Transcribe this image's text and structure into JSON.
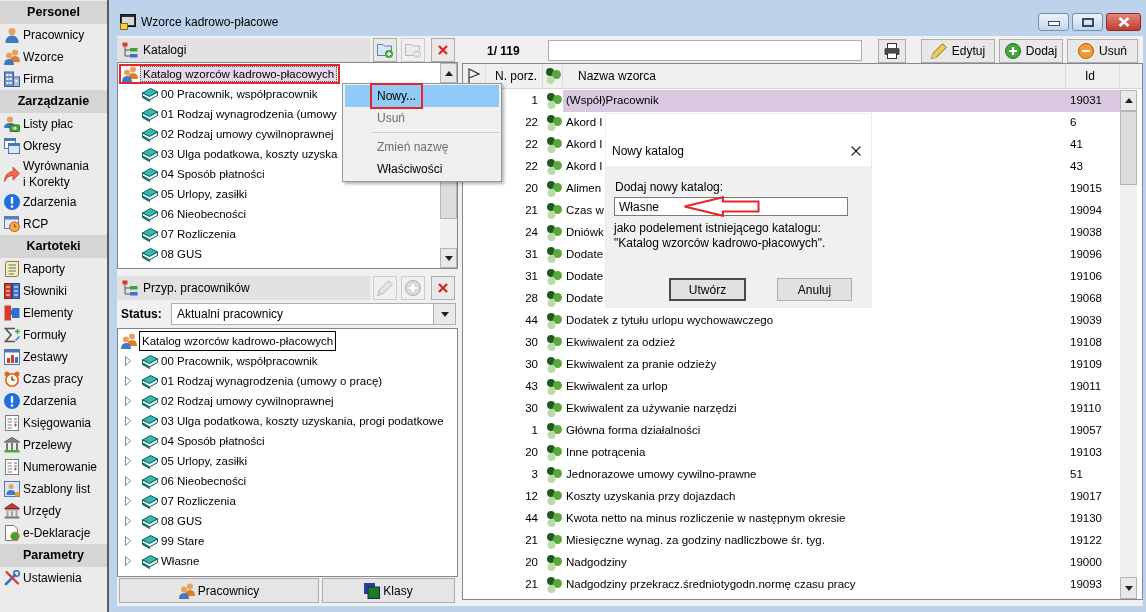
{
  "sidebar": {
    "sections": [
      {
        "title": "Personel",
        "items": [
          {
            "label": "Pracownicy"
          },
          {
            "label": "Wzorce"
          },
          {
            "label": "Firma"
          }
        ]
      },
      {
        "title": "Zarządzanie",
        "items": [
          {
            "label": "Listy płac"
          },
          {
            "label": "Okresy"
          },
          {
            "label": "Wyrównania\ni Korekty"
          },
          {
            "label": "Zdarzenia"
          },
          {
            "label": "RCP"
          }
        ]
      },
      {
        "title": "Kartoteki",
        "items": [
          {
            "label": "Raporty"
          },
          {
            "label": "Słowniki"
          },
          {
            "label": "Elementy"
          },
          {
            "label": "Formuły"
          },
          {
            "label": "Zestawy"
          },
          {
            "label": "Czas pracy"
          },
          {
            "label": "Zdarzenia"
          },
          {
            "label": "Księgowania"
          },
          {
            "label": "Przelewy"
          },
          {
            "label": "Numerowanie"
          },
          {
            "label": "Szablony list"
          },
          {
            "label": "Urzędy"
          },
          {
            "label": "e-Deklaracje"
          }
        ]
      },
      {
        "title": "Parametry",
        "items": [
          {
            "label": "Ustawienia"
          }
        ]
      }
    ]
  },
  "window": {
    "title": "Wzorce kadrowo-płacowe"
  },
  "catalogs": {
    "title": "Katalogi",
    "tools": [
      {
        "kind": "add-folder",
        "disabled": false
      },
      {
        "kind": "remove-folder",
        "disabled": true
      },
      {
        "kind": "delete",
        "disabled": false
      }
    ],
    "tree": {
      "label": "Katalog wzorców kadrowo-płacowych",
      "selected": true,
      "annotated": true,
      "children": [
        {
          "label": "00 Pracownik, współpracownik",
          "selected": false
        },
        {
          "label": "01 Rodzaj wynagrodzenia (umowy",
          "selected": false
        },
        {
          "label": "02 Rodzaj umowy cywilnoprawnej",
          "selected": false
        },
        {
          "label": "03 Ulga podatkowa, koszty uzyska",
          "selected": false
        },
        {
          "label": "04 Sposób płatności",
          "selected": false
        },
        {
          "label": "05 Urlopy, zasiłki",
          "selected": false
        },
        {
          "label": "06 Nieobecności",
          "selected": false
        },
        {
          "label": "07 Rozliczenia",
          "selected": false
        },
        {
          "label": "08 GUS",
          "selected": false
        }
      ]
    }
  },
  "context_menu": {
    "items": [
      {
        "label": "Nowy...",
        "selected": true,
        "disabled": false,
        "separator_before": false,
        "annotated": true
      },
      {
        "label": "Usuń",
        "selected": false,
        "disabled": true,
        "separator_before": false,
        "annotated": false
      },
      {
        "label": "Zmień nazwę",
        "selected": false,
        "disabled": true,
        "separator_before": true,
        "annotated": false
      },
      {
        "label": "Właściwości",
        "selected": false,
        "disabled": false,
        "separator_before": false,
        "annotated": false
      }
    ]
  },
  "assignments": {
    "title": "Przyp. pracowników",
    "tools": [
      {
        "kind": "edit",
        "disabled": true
      },
      {
        "kind": "add",
        "disabled": true
      },
      {
        "kind": "delete",
        "disabled": false
      }
    ],
    "status": {
      "label": "Status:",
      "value": "Aktualni pracownicy"
    },
    "tree": {
      "label": "Katalog wzorców kadrowo-płacowych",
      "selected": true,
      "children": [
        {
          "label": "00 Pracownik, współpracownik",
          "expanded": false
        },
        {
          "label": "01 Rodzaj wynagrodzenia (umowy o pracę)",
          "expanded": false
        },
        {
          "label": "02 Rodzaj umowy cywilnoprawnej",
          "expanded": false
        },
        {
          "label": "03 Ulga podatkowa, koszty uzyskania, progi podatkowe",
          "expanded": false
        },
        {
          "label": "04 Sposób płatności",
          "expanded": false
        },
        {
          "label": "05 Urlopy, zasiłki",
          "expanded": false
        },
        {
          "label": "06 Nieobecności",
          "expanded": false
        },
        {
          "label": "07 Rozliczenia",
          "expanded": false
        },
        {
          "label": "08 GUS",
          "expanded": false
        },
        {
          "label": "99 Stare",
          "expanded": false
        },
        {
          "label": "Własne",
          "expanded": false
        }
      ]
    },
    "buttons": [
      {
        "kind": "people",
        "label": "Pracownicy"
      },
      {
        "kind": "square",
        "label": "Klasy"
      }
    ]
  },
  "templates": {
    "counter": "1/ 119",
    "toolbar": [
      {
        "kind": "print"
      },
      {
        "kind": "edit",
        "label": "Edytuj"
      },
      {
        "kind": "add",
        "label": "Dodaj"
      },
      {
        "kind": "delete",
        "label": "Usuń"
      }
    ],
    "table": {
      "columns": [
        {
          "kind": "flag"
        },
        {
          "kind": "text",
          "label": "N. porz."
        },
        {
          "kind": "icon"
        },
        {
          "kind": "text",
          "label": "Nazwa wzorca"
        },
        {
          "kind": "text",
          "label": "Id"
        }
      ],
      "rows": [
        {
          "order": "1",
          "name": "(Współ)Pracownik",
          "id": "19031",
          "selected": true
        },
        {
          "order": "22",
          "name": "Akord I",
          "id": "6",
          "selected": false
        },
        {
          "order": "22",
          "name": "Akord I",
          "id": "41",
          "selected": false
        },
        {
          "order": "22",
          "name": "Akord I",
          "id": "43",
          "selected": false
        },
        {
          "order": "20",
          "name": "Alimen",
          "id": "19015",
          "selected": false
        },
        {
          "order": "21",
          "name": "Czas w",
          "id": "19094",
          "selected": false
        },
        {
          "order": "24",
          "name": "Dniówk",
          "id": "19038",
          "selected": false
        },
        {
          "order": "31",
          "name": "Dodate",
          "id": "19096",
          "selected": false
        },
        {
          "order": "31",
          "name": "Dodate",
          "id": "19106",
          "selected": false
        },
        {
          "order": "28",
          "name": "Dodate",
          "id": "19068",
          "selected": false
        },
        {
          "order": "44",
          "name": "Dodatek z tytułu urlopu wychowawczego",
          "id": "19039",
          "selected": false
        },
        {
          "order": "30",
          "name": "Ekwiwalent za odzież",
          "id": "19108",
          "selected": false
        },
        {
          "order": "30",
          "name": "Ekwiwalent za pranie odzieży",
          "id": "19109",
          "selected": false
        },
        {
          "order": "43",
          "name": "Ekwiwalent za urlop",
          "id": "19011",
          "selected": false
        },
        {
          "order": "30",
          "name": "Ekwiwalent za używanie narzędzi",
          "id": "19110",
          "selected": false
        },
        {
          "order": "1",
          "name": "Główna forma działalności",
          "id": "19057",
          "selected": false
        },
        {
          "order": "20",
          "name": "Inne potrącenia",
          "id": "19103",
          "selected": false
        },
        {
          "order": "3",
          "name": "Jednorazowe umowy cywilno-prawne",
          "id": "51",
          "selected": false
        },
        {
          "order": "12",
          "name": "Koszty uzyskania przy dojazdach",
          "id": "19017",
          "selected": false
        },
        {
          "order": "44",
          "name": "Kwota netto na minus rozliczenie w następnym okresie",
          "id": "19130",
          "selected": false
        },
        {
          "order": "21",
          "name": "Miesięczne wynag. za godziny nadliczbowe śr. tyg.",
          "id": "19122",
          "selected": false
        },
        {
          "order": "20",
          "name": "Nadgodziny",
          "id": "19000",
          "selected": false
        },
        {
          "order": "21",
          "name": "Nadgodziny przekracz.średniotygodn.normę czasu pracy",
          "id": "19093",
          "selected": false
        }
      ]
    }
  },
  "dialog": {
    "title": "Nowy katalog",
    "prompt": "Dodaj nowy katalog:",
    "field": {
      "value": "Własne",
      "annotated": true
    },
    "note": "jako podelement istniejącego katalogu:\n\"Katalog wzorców kadrowo-płacowych\".",
    "buttons": [
      {
        "label": "Utwórz",
        "default": true
      },
      {
        "label": "Anuluj",
        "default": false
      }
    ]
  }
}
